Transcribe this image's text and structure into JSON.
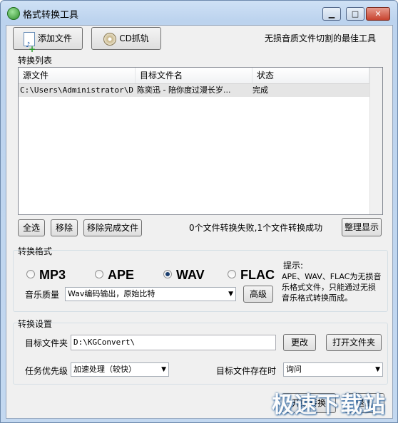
{
  "window": {
    "title": "格式转换工具",
    "min_glyph": "▁",
    "max_glyph": "□",
    "close_glyph": "✕"
  },
  "toolbar": {
    "add_file": "添加文件",
    "cd_rip": "CD抓轨",
    "slogan": "无损音质文件切割的最佳工具"
  },
  "list": {
    "group_label": "转换列表",
    "columns": [
      "源文件",
      "目标文件名",
      "状态"
    ],
    "rows": [
      {
        "source": "C:\\Users\\Administrator\\D...",
        "target": "陈奕迅 - 陪你度过漫长岁...",
        "status": "完成"
      }
    ]
  },
  "actions": {
    "select_all": "全选",
    "remove": "移除",
    "remove_done": "移除完成文件",
    "status": "0个文件转换失败,1个文件转换成功",
    "tidy": "整理显示"
  },
  "format": {
    "group_label": "转换格式",
    "options": [
      "MP3",
      "APE",
      "WAV",
      "FLAC"
    ],
    "selected": "WAV",
    "tip_title": "提示:",
    "tip_text": "APE、WAV、FLAC为无损音乐格式文件，只能通过无损音乐格式转换而成。",
    "quality_label": "音乐质量",
    "quality_value": "Wav编码输出，原始比特",
    "advanced": "高级"
  },
  "settings": {
    "group_label": "转换设置",
    "target_folder_label": "目标文件夹",
    "target_folder_value": "D:\\KGConvert\\",
    "change": "更改",
    "open_folder": "打开文件夹",
    "priority_label": "任务优先级",
    "priority_value": "加速处理（较快）",
    "exists_label": "目标文件存在时",
    "exists_value": "询问"
  },
  "footer": {
    "start": "开始转换",
    "exit": "退出"
  },
  "watermark": "极速下载站"
}
